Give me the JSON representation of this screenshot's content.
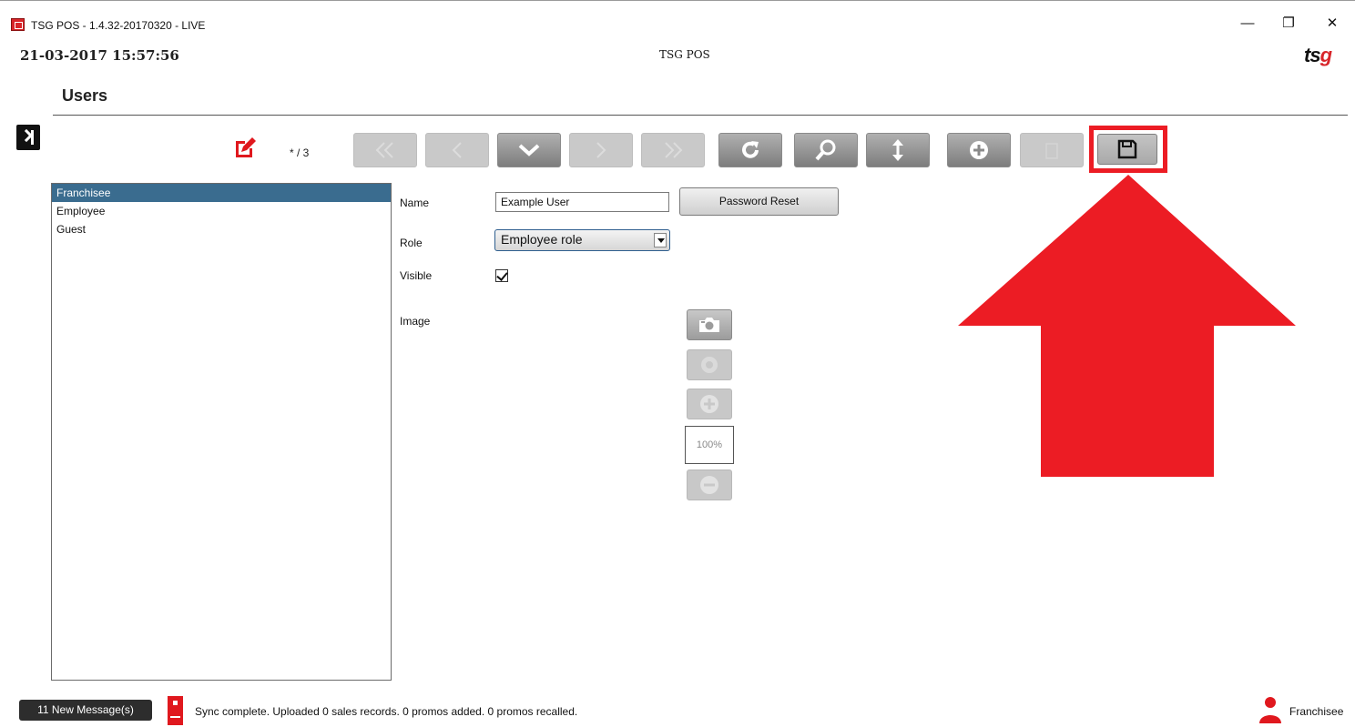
{
  "window": {
    "title": "TSG POS - 1.4.32-20170320 - LIVE",
    "minimize": "—",
    "restore": "❐",
    "close": "✕"
  },
  "header": {
    "datetime": "21-03-2017 15:57:56",
    "app_name": "TSG POS",
    "logo_main": "ts",
    "logo_accent": "g",
    "page_title": "Users"
  },
  "toolbar": {
    "record_count": "* / 3",
    "buttons": [
      {
        "name": "first-record",
        "icon": "double-chevron-left",
        "enabled": false
      },
      {
        "name": "previous-record",
        "icon": "chevron-left",
        "enabled": false
      },
      {
        "name": "dropdown",
        "icon": "chevron-down",
        "enabled": true
      },
      {
        "name": "next-record",
        "icon": "chevron-right",
        "enabled": false
      },
      {
        "name": "last-record",
        "icon": "double-chevron-right",
        "enabled": false
      },
      {
        "name": "refresh",
        "icon": "refresh",
        "enabled": true
      },
      {
        "name": "search",
        "icon": "magnifier",
        "enabled": true
      },
      {
        "name": "sort",
        "icon": "vertical-arrows",
        "enabled": true
      },
      {
        "name": "add",
        "icon": "plus-circle",
        "enabled": true
      },
      {
        "name": "delete",
        "icon": "trash",
        "enabled": false
      },
      {
        "name": "save",
        "icon": "floppy-disk",
        "enabled": true
      }
    ]
  },
  "users": {
    "items": [
      "Franchisee",
      "Employee",
      "Guest"
    ],
    "selected": "Franchisee"
  },
  "form": {
    "name_label": "Name",
    "name_value": "Example User",
    "password_reset": "Password Reset",
    "role_label": "Role",
    "role_value": "Employee role",
    "visible_label": "Visible",
    "visible_checked": true,
    "image_label": "Image",
    "zoom": "100%"
  },
  "status": {
    "messages_button": "11 New Message(s)",
    "sync_text": "Sync complete.  Uploaded 0 sales records. 0 promos added. 0 promos recalled.",
    "current_user": "Franchisee"
  },
  "colors": {
    "accent_red": "#ec1c24",
    "selection_blue": "#3a6c8f"
  }
}
